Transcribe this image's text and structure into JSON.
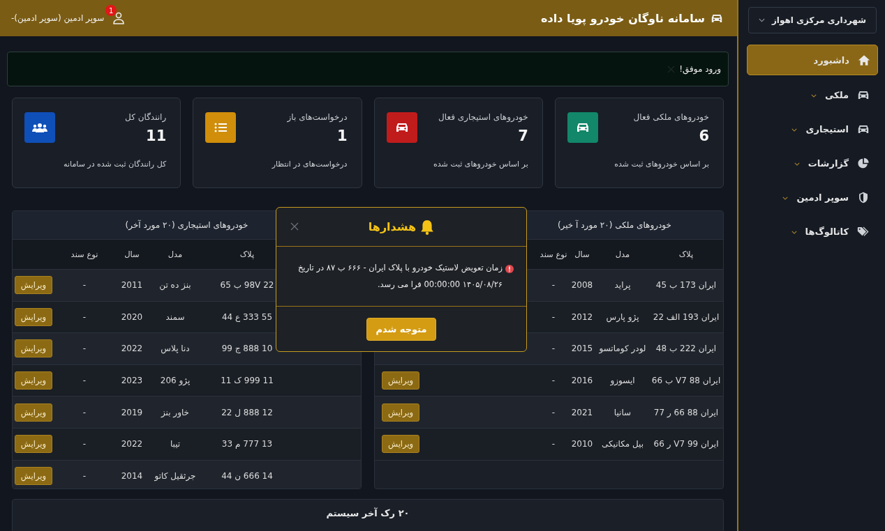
{
  "header": {
    "title": "سامانه ناوگان خودرو پویا داده",
    "user": "سوپر ادمین (سوپر ادمین)-",
    "notification_count": "1"
  },
  "sidebar": {
    "organization": "شهرداری مرکزی اهواز",
    "items": [
      {
        "label": "داشبورد",
        "selected": true,
        "expandable": false
      },
      {
        "label": "ملکی",
        "selected": false,
        "expandable": true
      },
      {
        "label": "استیجاری",
        "selected": false,
        "expandable": true
      },
      {
        "label": "گزارشات",
        "selected": false,
        "expandable": true
      },
      {
        "label": "سوپر ادمین",
        "selected": false,
        "expandable": true
      },
      {
        "label": "کاتالوگ‌ها",
        "selected": false,
        "expandable": true
      }
    ]
  },
  "alert": {
    "message": "ورود موفق!"
  },
  "stats": [
    {
      "title": "خودروهای ملکی فعال",
      "value": "6",
      "note": "بر اساس خودروهای ثبت شده",
      "color": "#12876a"
    },
    {
      "title": "خودروهای استیجاری فعال",
      "value": "7",
      "note": "بر اساس خودروهای ثبت شده",
      "color": "#c01c1c"
    },
    {
      "title": "درخواست‌های باز",
      "value": "1",
      "note": "درخواست‌های در انتظار",
      "color": "#d08e0a"
    },
    {
      "title": "رانندگان کل",
      "value": "11",
      "note": "کل رانندگان ثبت شده در سامانه",
      "color": "#0f4fb8"
    }
  ],
  "tables": [
    {
      "title": "خودروهای ملکی (۲۰ مورد آ خیر)",
      "columns": [
        "پلاک",
        "مدل",
        "سال",
        "نوع سند"
      ],
      "rows": [
        {
          "cells": [
            "ایران 173 ب 45",
            "پراید",
            "2008",
            "-"
          ]
        },
        {
          "cells": [
            "ایران 193 الف 22",
            "پژو پارس",
            "2012",
            "-"
          ]
        },
        {
          "cells": [
            "ایران 222 ب 48",
            "لودر کوماتسو",
            "2015",
            "-"
          ]
        },
        {
          "cells": [
            "ایران 88 V7 ب 66",
            "ایسوزو",
            "2016",
            "-"
          ],
          "action": "ویرایش"
        },
        {
          "cells": [
            "ایران 88 66 ر 77",
            "سانیا",
            "2021",
            "-"
          ],
          "action": "ویرایش"
        },
        {
          "cells": [
            "ایران 99 V7 ر 66",
            "بیل مکانیکی",
            "2010",
            "-"
          ],
          "action": "ویرایش"
        }
      ]
    },
    {
      "title": "خودروهای استیجاری (۲۰ مورد آخر)",
      "columns": [
        "پلاک",
        "مدل",
        "سال",
        "نوع سند"
      ],
      "rows": [
        {
          "cells": [
            "22 98V ب 65",
            "بنز ده تن",
            "2011",
            "-"
          ],
          "action": "ویرایش"
        },
        {
          "cells": [
            "55 333 ع 44",
            "سمند",
            "2020",
            "-"
          ],
          "action": "ویرایش"
        },
        {
          "cells": [
            "10 888 ج 99",
            "دنا پلاس",
            "2022",
            "-"
          ],
          "action": "ویرایش"
        },
        {
          "cells": [
            "11 999 ک 11",
            "پژو 206",
            "2023",
            "-"
          ],
          "action": "ویرایش"
        },
        {
          "cells": [
            "12 888 ل 22",
            "خاور بنز",
            "2019",
            "-"
          ],
          "action": "ویرایش"
        },
        {
          "cells": [
            "13 777 م 33",
            "تیبا",
            "2022",
            "-"
          ],
          "action": "ویرایش"
        },
        {
          "cells": [
            "14 666 ن 44",
            "جرثقیل کاتو",
            "2014",
            "-"
          ],
          "action": "ویرایش"
        }
      ]
    }
  ],
  "bottom_card": {
    "title": "۲۰ رک آخر سیستم"
  },
  "modal": {
    "title": "هشدارها",
    "message": "زمان تعویض لاستیک خودرو با پلاک ایران - ۶۶۶ ب ۸۷ در تاریخ ۱۴۰۵/۰۸/۲۶ 00:00:00 فرا می رسد.",
    "button": "متوجه شدم"
  }
}
